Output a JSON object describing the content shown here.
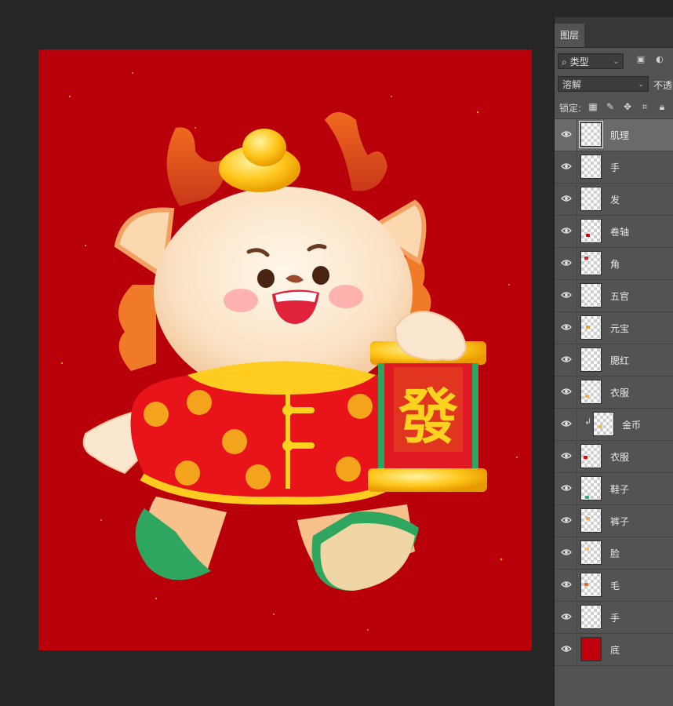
{
  "canvas": {
    "background": "#b9000a",
    "scroll_text": "發"
  },
  "panel": {
    "tab": "图层",
    "filter": {
      "kind_label": "类型"
    },
    "blend": {
      "mode": "溶解",
      "opacity_label": "不透明"
    },
    "lock": {
      "label": "锁定:"
    },
    "layers": [
      {
        "name": "肌理",
        "selected": true
      },
      {
        "name": "手"
      },
      {
        "name": "发"
      },
      {
        "name": "卷轴"
      },
      {
        "name": "角"
      },
      {
        "name": "五官"
      },
      {
        "name": "元宝"
      },
      {
        "name": "腮红"
      },
      {
        "name": "衣服"
      },
      {
        "name": "金币",
        "clipped": true
      },
      {
        "name": "衣服"
      },
      {
        "name": "鞋子"
      },
      {
        "name": "裤子"
      },
      {
        "name": "脸"
      },
      {
        "name": "毛"
      },
      {
        "name": "手"
      },
      {
        "name": "底",
        "solid_color": "#c0000c"
      }
    ]
  }
}
